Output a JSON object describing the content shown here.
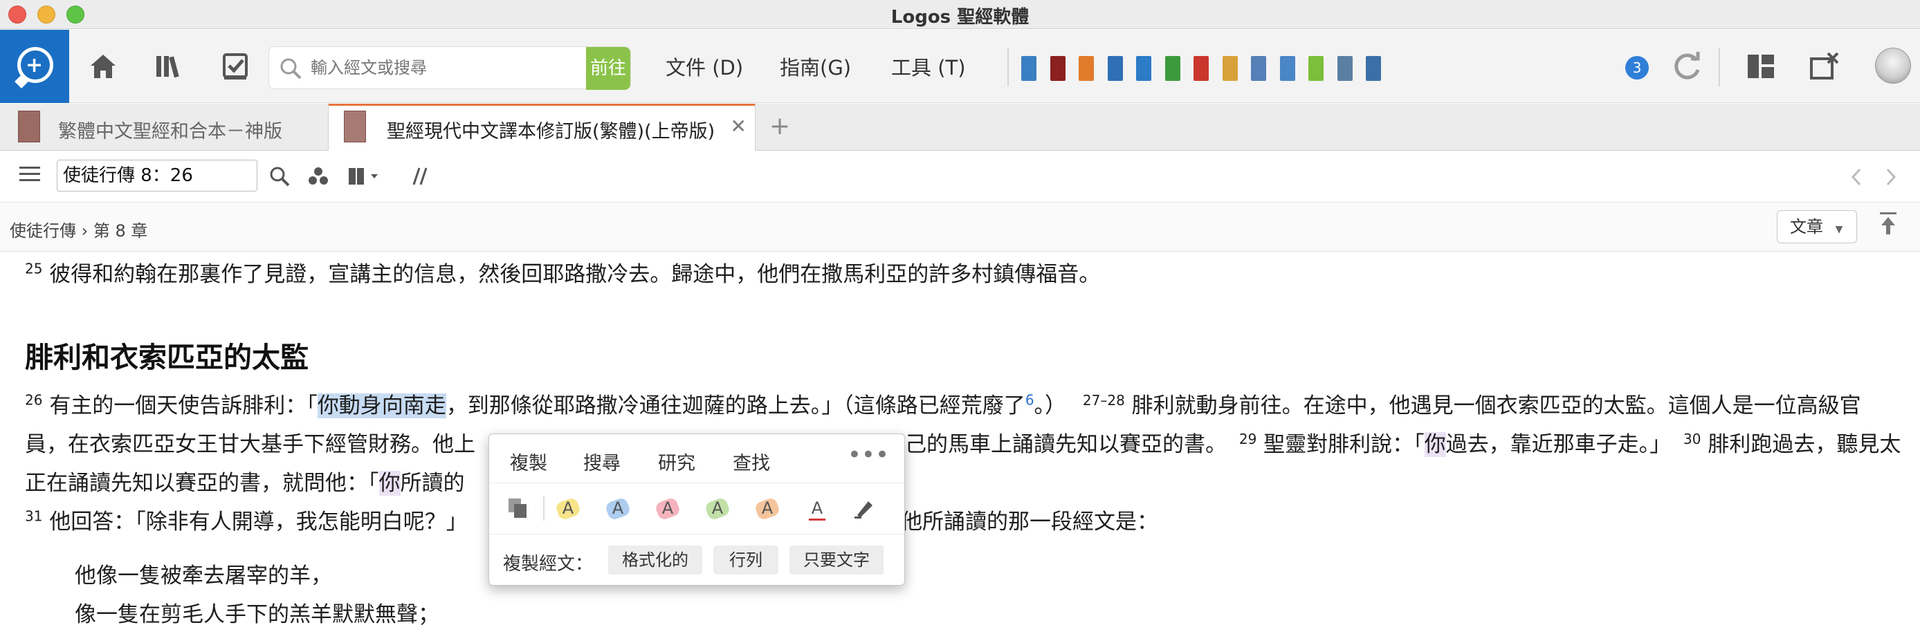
{
  "window": {
    "title": "Logos 聖經軟體"
  },
  "toolbar": {
    "search_placeholder": "輸入經文或搜尋",
    "go_label": "前往",
    "menu_documents": "文件 (D)",
    "menu_guides": "指南(G)",
    "menu_tools": "工具 (T)",
    "notification_count": "3",
    "book_icon_colors": [
      "#3a7fc1",
      "#8b2020",
      "#e07b2a",
      "#2f6fb5",
      "#2b7bc6",
      "#3c9a3c",
      "#c9372c",
      "#d8a13a",
      "#5580b8",
      "#4a86c8",
      "#7bbf3a",
      "#5a7fa3",
      "#3b6fa8"
    ]
  },
  "tabs": [
    {
      "label": "繁體中文聖經和合本－神版",
      "active": false
    },
    {
      "label": "聖經現代中文譯本修訂版(繁體)(上帝版)",
      "active": true
    }
  ],
  "passage": {
    "reference": "使徒行傳 8：26"
  },
  "breadcrumb": {
    "book": "使徒行傳",
    "separator": "›",
    "chapter": "第 8 章",
    "view_label": "文章"
  },
  "content": {
    "v25_num": "25",
    "v25_text": "彼得和約翰在那裏作了見證，宣講主的信息，然後回耶路撒冷去。歸途中，他們在撒馬利亞的許多村鎮傳福音。",
    "heading": "腓利和衣索匹亞的太監",
    "v26_num": "26",
    "v26_pre": "有主的一個天使告訴腓利：「",
    "v26_highlight": "你動身向南走",
    "v26_post": "，到那條從耶路撒冷通往迦薩的路上去。」（這條路已經荒廢了",
    "v26_footnote": "6",
    "v26_end": "。）",
    "v27_num": "27–28",
    "v27_text": "腓利就動身前往。在途中，他遇見一個衣索匹亞的太監。這個人是一位高級官",
    "line3_start": "員，在衣索匹亞女王甘大基手下經管財務。他上",
    "line3_right": "己的馬車上誦讀先知以賽亞的書。",
    "v29_num": "29",
    "v29_text_a": "聖靈對腓利說：「",
    "v29_hl": "你",
    "v29_text_b": "過去，靠近那車子走。」",
    "v30_num": "30",
    "v30_text": "腓利跑過去，聽見太",
    "line4_start": "正在誦讀先知以賽亞的書，就問他：「",
    "line4_hl": "你",
    "line4_end": "所讀的",
    "v31_num": "31",
    "v31_text": "他回答：「除非有人開導，我怎能明白呢？」",
    "v31_right": "他所誦讀的那一段經文是：",
    "poem_1": "他像一隻被牽去屠宰的羊，",
    "poem_2": "像一隻在剪毛人手下的羔羊默默無聲；"
  },
  "popup": {
    "copy": "複製",
    "search": "搜尋",
    "research": "研究",
    "find": "查找",
    "more": "•••",
    "copy_verse_label": "複製經文：",
    "opt_formatted": "格式化的",
    "opt_inline": "行列",
    "opt_text_only": "只要文字",
    "highlight_letter": "A",
    "highlight_colors": [
      "#f3d54a",
      "#7fb2e6",
      "#ef8a9a",
      "#9fd17a",
      "#f0a566"
    ],
    "font_color": "#d63a3a"
  }
}
